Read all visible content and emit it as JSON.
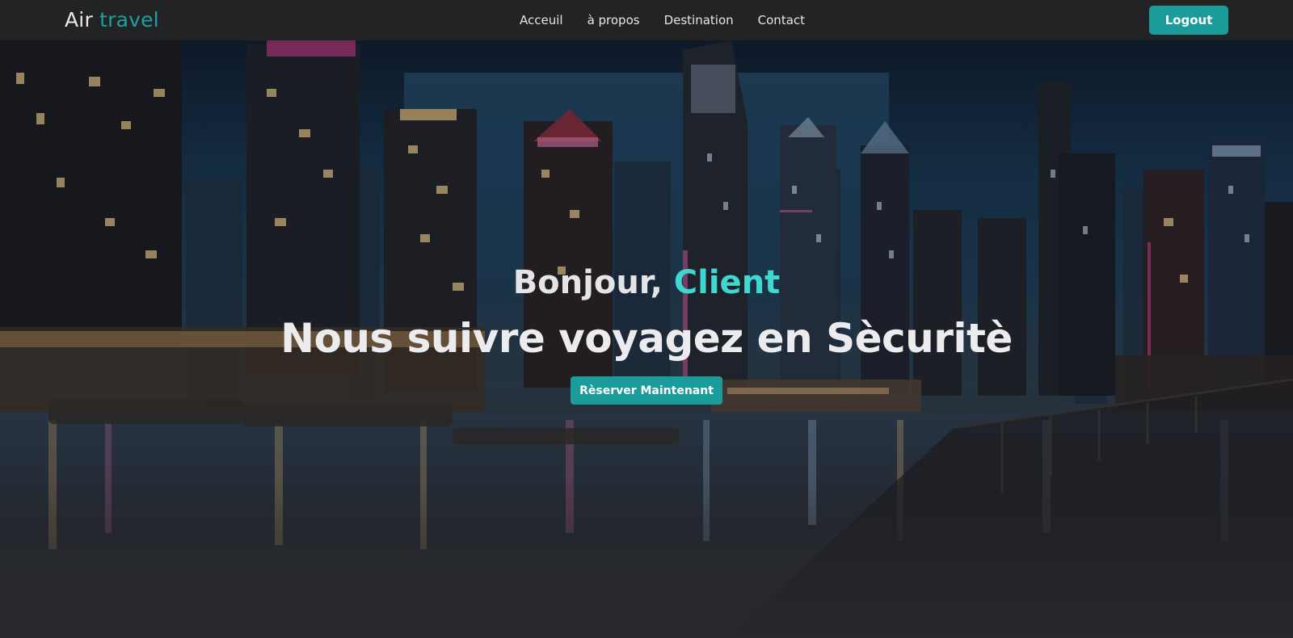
{
  "navbar": {
    "brand": {
      "word1": "Air",
      "word2": "travel"
    },
    "links": [
      {
        "label": "Acceuil"
      },
      {
        "label": "à propos"
      },
      {
        "label": "Destination"
      },
      {
        "label": "Contact"
      }
    ],
    "logout_label": "Logout"
  },
  "hero": {
    "greeting_prefix": "Bonjour, ",
    "greeting_name": "Client",
    "headline": "Nous suivre voyagez en Sècuritè",
    "cta_label": "Rèserver Maintenant"
  },
  "colors": {
    "accent": "#1b9c9b",
    "accent_text": "#3fd7cf",
    "navbar_bg": "#222324"
  }
}
